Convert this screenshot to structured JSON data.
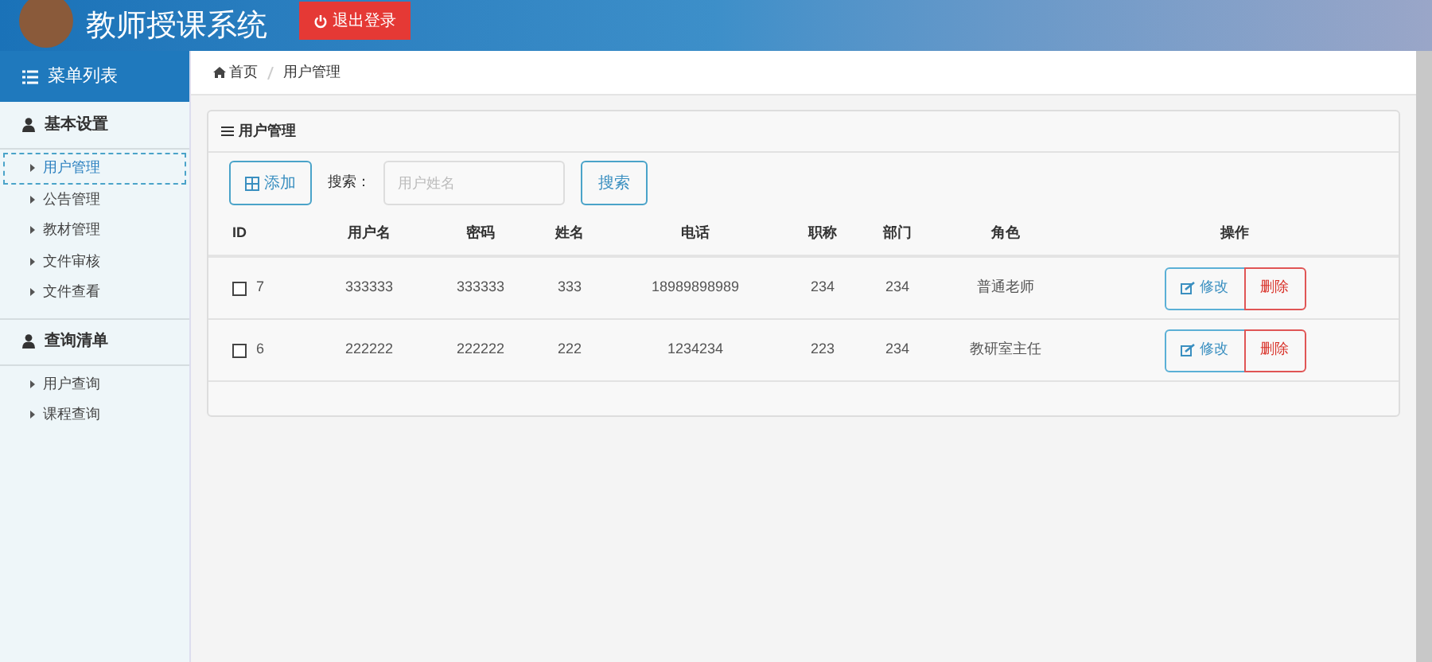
{
  "header": {
    "title": "教师授课系统",
    "logout_button": "退出登录"
  },
  "sidebar": {
    "title": "菜单列表",
    "groups": [
      {
        "label": "基本设置",
        "items": [
          {
            "label": "用户管理",
            "selected": true
          },
          {
            "label": "公告管理",
            "selected": false
          },
          {
            "label": "教材管理",
            "selected": false
          },
          {
            "label": "文件审核",
            "selected": false
          },
          {
            "label": "文件查看",
            "selected": false
          }
        ]
      },
      {
        "label": "查询清单",
        "items": [
          {
            "label": "用户查询",
            "selected": false
          },
          {
            "label": "课程查询",
            "selected": false
          }
        ]
      }
    ]
  },
  "breadcrumb": [
    "首页",
    "用户管理"
  ],
  "panel": {
    "title": "用户管理",
    "add_button": "添加",
    "search_label": "搜索：",
    "search_placeholder": "用户姓名",
    "search_button": "搜索",
    "table": {
      "columns": [
        "ID",
        "用户名",
        "密码",
        "姓名",
        "电话",
        "职称",
        "部门",
        "角色",
        "操作"
      ],
      "rows": [
        {
          "checked": false,
          "cells": [
            "7",
            "333333",
            "333333",
            "333",
            "18989898989",
            "234",
            "234",
            "普通老师"
          ],
          "actions": [
            "修改",
            "删除"
          ]
        },
        {
          "checked": false,
          "cells": [
            "6",
            "222222",
            "222222",
            "222",
            "1234234",
            "223",
            "234",
            "教研室主任"
          ],
          "actions": [
            "修改",
            "删除"
          ]
        }
      ]
    }
  }
}
